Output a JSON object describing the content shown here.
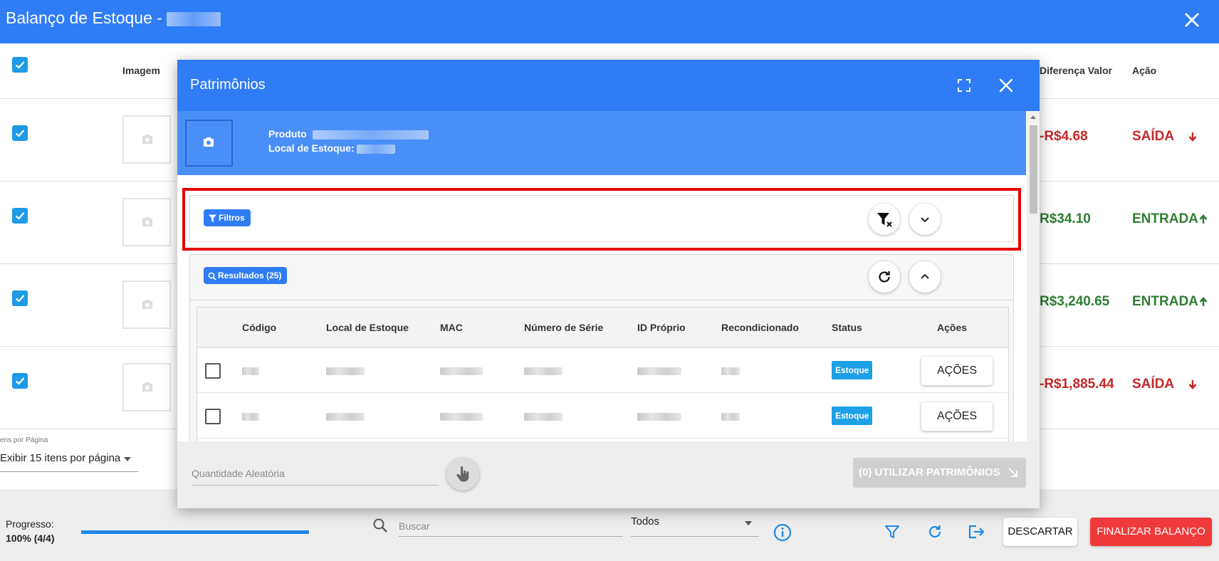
{
  "app": {
    "title": "Balanço de Estoque - ",
    "accent": "#2e7cf6"
  },
  "bg_table": {
    "headers": {
      "imagem": "Imagem",
      "diferenca_valor": "Diferença Valor",
      "acao": "Ação"
    },
    "rows": [
      {
        "diff": "-R$4.68",
        "action": "SAÍDA",
        "direction": "down",
        "tone": "red"
      },
      {
        "diff": "R$34.10",
        "action": "ENTRADA",
        "direction": "up",
        "tone": "green"
      },
      {
        "diff": "R$3,240.65",
        "action": "ENTRADA",
        "direction": "up",
        "tone": "green"
      },
      {
        "diff": "-R$1,885.44",
        "action": "SAÍDA",
        "direction": "down",
        "tone": "red"
      }
    ]
  },
  "pager": {
    "label": "ens por Página",
    "selected": "Exibir 15 itens por página"
  },
  "footer": {
    "progress_label": "Progresso:",
    "progress_value": "100% (4/4)",
    "progress_fraction": 1.0,
    "search_placeholder": "Buscar",
    "filter_select": "Todos",
    "discard_label": "DESCARTAR",
    "finalize_label": "FINALIZAR BALANÇO",
    "finalize_color": "#f03a3a"
  },
  "modal": {
    "title": "Patrimônios",
    "product_label": "Produto",
    "local_label": "Local de Estoque:",
    "filters_chip": "Filtros",
    "results_chip": "Resultados (25)",
    "columns": [
      "Código",
      "Local de Estoque",
      "MAC",
      "Número de Série",
      "ID Próprio",
      "Recondicionado",
      "Status",
      "Ações"
    ],
    "rows": [
      {
        "status": "Estoque",
        "actions_label": "AÇÕES"
      },
      {
        "status": "Estoque",
        "actions_label": "AÇÕES"
      }
    ],
    "qty_placeholder": "Quantidade Aleatória",
    "use_button": "(0) UTILIZAR PATRIMÔNIOS",
    "highlight_color": "#e60000"
  }
}
